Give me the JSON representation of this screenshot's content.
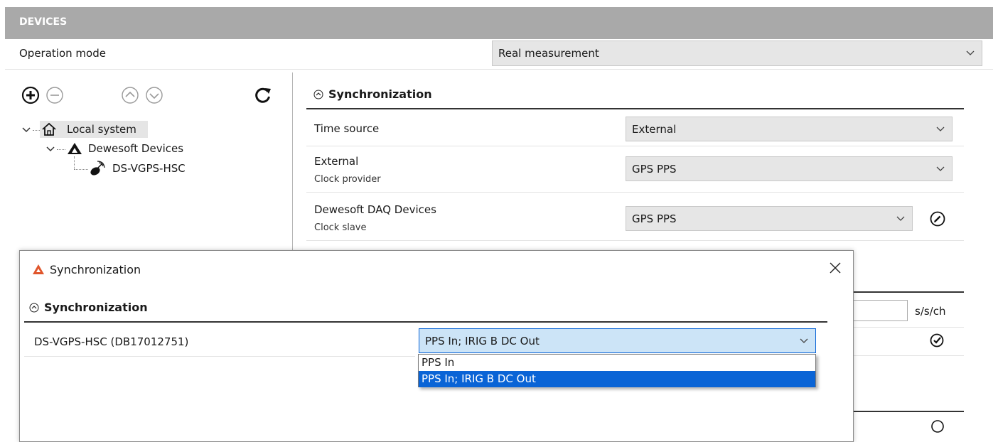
{
  "header": {
    "title": "DEVICES"
  },
  "operation_mode": {
    "label": "Operation mode",
    "value": "Real measurement"
  },
  "toolbar": {
    "add_icon": "add-circle-icon",
    "remove_icon": "remove-circle-icon",
    "up_icon": "arrow-up-circle-icon",
    "down_icon": "arrow-down-circle-icon",
    "refresh_icon": "refresh-icon"
  },
  "tree": {
    "root": "Local system",
    "child": "Dewesoft Devices",
    "leaf": "DS-VGPS-HSC"
  },
  "sync_panel": {
    "title": "Synchronization",
    "rows": [
      {
        "label": "Time source",
        "sub": "",
        "value": "External"
      },
      {
        "label": "External",
        "sub": "Clock provider",
        "value": "GPS PPS"
      },
      {
        "label": "Dewesoft DAQ Devices",
        "sub": "Clock slave",
        "value": "GPS PPS"
      }
    ],
    "unit": "s/s/ch"
  },
  "dialog": {
    "title": "Synchronization",
    "section_title": "Synchronization",
    "device_label": "DS-VGPS-HSC (DB17012751)",
    "selected_value": "PPS In; IRIG B DC Out",
    "options": [
      "PPS In",
      "PPS In; IRIG B DC Out"
    ],
    "selected_index": 1
  },
  "colors": {
    "header_bg": "#a9a9a9",
    "select_bg": "#e6e6e6",
    "highlight": "#0a64d6",
    "brand": "#e0552b"
  }
}
